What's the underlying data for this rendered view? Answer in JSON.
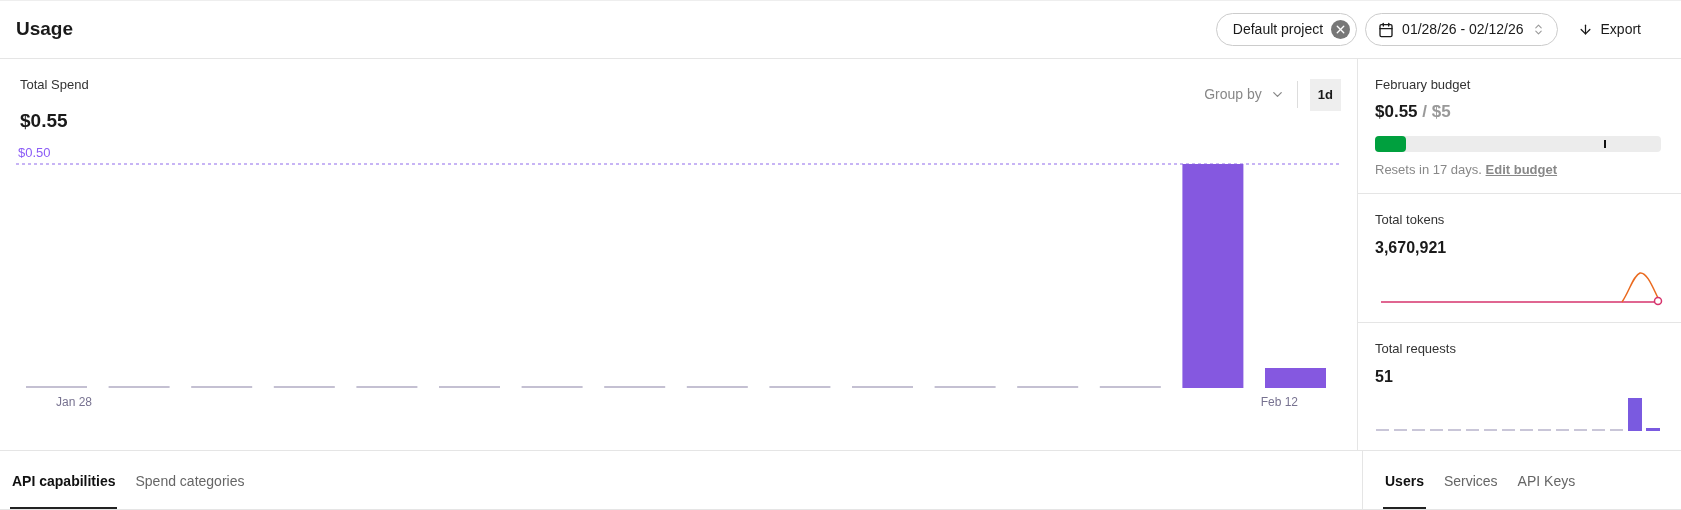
{
  "header": {
    "title": "Usage",
    "project_filter": "Default project",
    "date_range": "01/28/26 - 02/12/26",
    "export": "Export"
  },
  "spend": {
    "title": "Total Spend",
    "value": "$0.55",
    "group_by": "Group by",
    "interval": "1d",
    "reference_label": "$0.50",
    "x_labels": [
      "Jan 28",
      "Feb 12"
    ]
  },
  "budget": {
    "title": "February budget",
    "spent": "$0.55",
    "limit": "/ $5",
    "level": 0.11,
    "note": "Resets in 17 days.",
    "edit_link": "Edit budget"
  },
  "tokens": {
    "title": "Total tokens",
    "value": "3,670,921"
  },
  "requests": {
    "title": "Total requests",
    "value": "51"
  },
  "left_tabs": [
    {
      "label": "API capabilities",
      "selected": true
    },
    {
      "label": "Spend categories",
      "selected": false
    }
  ],
  "right_tabs": [
    {
      "label": "Users",
      "selected": true
    },
    {
      "label": "Services",
      "selected": false
    },
    {
      "label": "API Keys",
      "selected": false
    }
  ]
}
